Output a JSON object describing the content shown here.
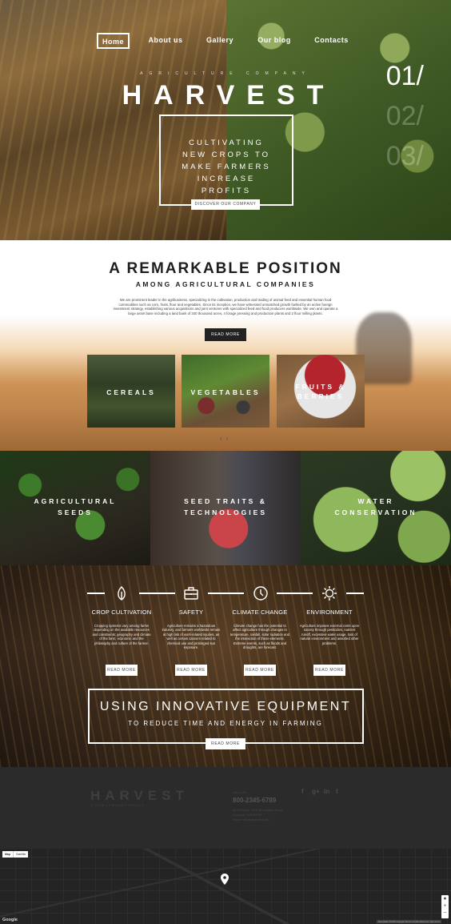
{
  "nav": {
    "items": [
      {
        "label": "Home",
        "active": true
      },
      {
        "label": "About us"
      },
      {
        "label": "Gallery"
      },
      {
        "label": "Our blog"
      },
      {
        "label": "Contacts"
      }
    ]
  },
  "hero": {
    "small_brand": "AGRICULTURE COMPANY",
    "brand": "HARVEST",
    "tagline": "CULTIVATING NEW CROPS TO MAKE FARMERS INCREASE PROFITS",
    "button": "DISCOVER OUR COMPANY",
    "slides": [
      "01/",
      "02/",
      "03/"
    ]
  },
  "position": {
    "title": "A REMARKABLE POSITION",
    "subtitle": "AMONG AGRICULTURAL COMPANIES",
    "text": "We are prominent leader in the agribusiness, specializing in the cultivation, production and trading of animal feed and essential human food commodities such as corn, fruits, flour and vegetables. Since its inception, we have witnessed unmatched growth fuelled by an active foreign investment strategy, establishing various acquisitions and joint ventures with specialized feed and food producers worldwide. We own and operate a large asset base including a land bank of 340 thousand acres, 4 forage pressing and production plants and 2 flour milling plants.",
    "button": "READ MORE",
    "cards": [
      {
        "label": "CEREALS"
      },
      {
        "label": "VEGETABLES"
      },
      {
        "label": "FRUITS & BERRIES"
      }
    ],
    "arrows": "‹ ›"
  },
  "tiles": [
    {
      "label": "AGRICULTURAL SEEDS"
    },
    {
      "label": "SEED TRAITS & TECHNOLOGIES"
    },
    {
      "label": "WATER CONSERVATION"
    }
  ],
  "features": [
    {
      "icon": "leaf-icon",
      "title": "CROP CULTIVATION",
      "text": "Cropping systems vary among farms depending on the available resources and constraints; geography and climate of the farm; economic and the philosophy and culture of the farmer.",
      "button": "READ MORE"
    },
    {
      "icon": "briefcase-icon",
      "title": "SAFETY",
      "text": "Agriculture remains a hazardous industry, and farmers worldwide remain at high risk of work-related injuries, as well as certain cancers related to chemical use and prolonged sun exposure.",
      "button": "READ MORE"
    },
    {
      "icon": "clock-icon",
      "title": "CLIMATE CHANGE",
      "text": "Climate change has the potential to affect agriculture through changes in temperature, rainfall, solar radiation and the interaction of these elements. Extreme events, such as floods and droughts, are forecast.",
      "button": "READ MORE"
    },
    {
      "icon": "sun-icon",
      "title": "ENVIRONMENT",
      "text": "Agriculture imposes external costs upon society through pesticides, nutrient runoff, excessive water usage, loss of natural environment and assorted other problems.",
      "button": "READ MORE"
    }
  ],
  "innovation": {
    "title": "USING INNOVATIVE EQUIPMENT",
    "subtitle": "TO REDUCE TIME AND ENERGY IN FARMING",
    "button": "READ MORE"
  },
  "footer": {
    "brand": "HARVEST",
    "copyright": "© 2016 | PRIVACY POLICY",
    "call_label": "CALL US",
    "phone": "800-2345-6789",
    "address": "4th Floor/rd, 3076 Bloomfield Road, Glasgow, D04 89GR",
    "email": "Email: info@demolink.org",
    "social": [
      "f",
      "g+",
      "in",
      "t"
    ]
  },
  "map": {
    "map_label": "Map",
    "satellite_label": "Satellite",
    "google": "Google",
    "terms": "Map data ©2016 Google  Terms of Use  Report a map error"
  },
  "colors": {
    "dark_button": "#222222",
    "footer_bg": "#2b2b2b",
    "map_bg": "#242424"
  }
}
